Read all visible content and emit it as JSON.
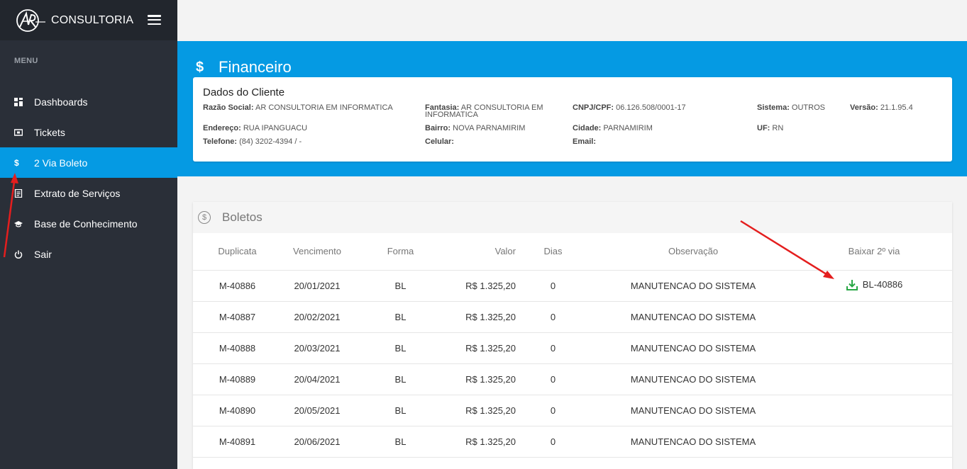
{
  "brand": {
    "name": "CONSULTORIA",
    "logo": "ar-logo"
  },
  "sidebar": {
    "menu_label": "MENU",
    "items": [
      {
        "label": "Dashboards",
        "icon": "grid-icon",
        "active": false
      },
      {
        "label": "Tickets",
        "icon": "ticket-icon",
        "active": false
      },
      {
        "label": "2 Via Boleto",
        "icon": "dollar-icon",
        "active": true
      },
      {
        "label": "Extrato de Serviços",
        "icon": "document-icon",
        "active": false
      },
      {
        "label": "Base de Conhecimento",
        "icon": "graduation-cap-icon",
        "active": false
      },
      {
        "label": "Sair",
        "icon": "power-icon",
        "active": false
      }
    ]
  },
  "page": {
    "title_icon": "$",
    "title": "Financeiro"
  },
  "client": {
    "title": "Dados do Cliente",
    "razao_label": "Razão Social:",
    "razao": "AR CONSULTORIA EM INFORMATICA",
    "fantasia_label": "Fantasia:",
    "fantasia_1": "AR CONSULTORIA EM",
    "fantasia_2": "INFORMATICA",
    "cnpj_label": "CNPJ/CPF:",
    "cnpj": "06.126.508/0001-17",
    "sistema_label": "Sistema:",
    "sistema": "OUTROS",
    "versao_label": "Versão:",
    "versao": "21.1.95.4",
    "endereco_label": "Endereço:",
    "endereco": "RUA IPANGUACU",
    "bairro_label": "Bairro:",
    "bairro": "NOVA PARNAMIRIM",
    "cidade_label": "Cidade:",
    "cidade": "PARNAMIRIM",
    "uf_label": "UF:",
    "uf": "RN",
    "telefone_label": "Telefone:",
    "telefone": "(84) 3202-4394 / -",
    "celular_label": "Celular:",
    "email_label": "Email:"
  },
  "boletos": {
    "title": "Boletos",
    "headers": [
      "Duplicata",
      "Vencimento",
      "Forma",
      "Valor",
      "Dias",
      "Observação",
      "Baixar 2º via"
    ],
    "rows": [
      {
        "duplicata": "M-40886",
        "vencimento": "20/01/2021",
        "forma": "BL",
        "valor": "R$ 1.325,20",
        "dias": "0",
        "observacao": "MANUTENCAO DO SISTEMA",
        "baixar": "BL-40886"
      },
      {
        "duplicata": "M-40887",
        "vencimento": "20/02/2021",
        "forma": "BL",
        "valor": "R$ 1.325,20",
        "dias": "0",
        "observacao": "MANUTENCAO DO SISTEMA",
        "baixar": ""
      },
      {
        "duplicata": "M-40888",
        "vencimento": "20/03/2021",
        "forma": "BL",
        "valor": "R$ 1.325,20",
        "dias": "0",
        "observacao": "MANUTENCAO DO SISTEMA",
        "baixar": ""
      },
      {
        "duplicata": "M-40889",
        "vencimento": "20/04/2021",
        "forma": "BL",
        "valor": "R$ 1.325,20",
        "dias": "0",
        "observacao": "MANUTENCAO DO SISTEMA",
        "baixar": ""
      },
      {
        "duplicata": "M-40890",
        "vencimento": "20/05/2021",
        "forma": "BL",
        "valor": "R$ 1.325,20",
        "dias": "0",
        "observacao": "MANUTENCAO DO SISTEMA",
        "baixar": ""
      },
      {
        "duplicata": "M-40891",
        "vencimento": "20/06/2021",
        "forma": "BL",
        "valor": "R$ 1.325,20",
        "dias": "0",
        "observacao": "MANUTENCAO DO SISTEMA",
        "baixar": ""
      }
    ]
  },
  "colors": {
    "sidebar": "#2a2f38",
    "brand_bar": "#22262d",
    "accent": "#059ae3",
    "download": "#28a745",
    "annotation": "#e41e1e"
  }
}
